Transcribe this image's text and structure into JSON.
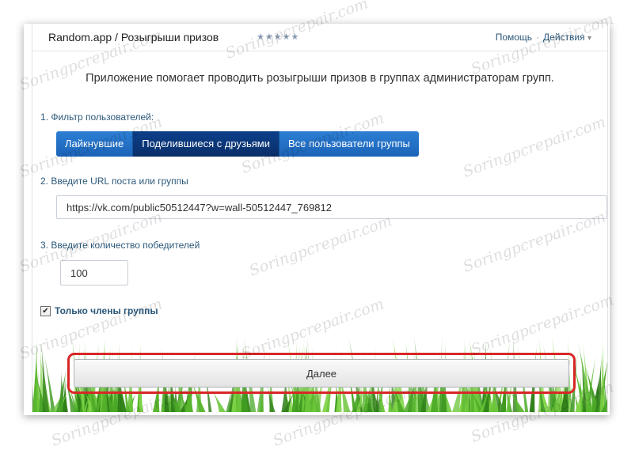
{
  "header": {
    "title": "Random.app / Розыгрыши призов",
    "stars": "★★★★★",
    "help_link": "Помощь",
    "separator": "·",
    "actions_link": "Действия",
    "actions_chevron": "▾"
  },
  "description": "Приложение помогает проводить розыгрыши призов в группах администраторам групп.",
  "filter": {
    "label": "1. Фильтр пользователей:",
    "options": [
      "Лайкнувшие",
      "Поделившиеся с друзьями",
      "Все пользователи группы"
    ],
    "active_index": 1
  },
  "url_section": {
    "label": "2. Введите URL поста или группы",
    "value": "https://vk.com/public50512447?w=wall-50512447_769812"
  },
  "winners_section": {
    "label": "3. Введите количество победителей",
    "value": "100"
  },
  "members_only": {
    "label": "Только члены группы",
    "checked": true,
    "check_glyph": "✔"
  },
  "next_button": {
    "label": "Далее"
  },
  "watermark_text": "Soringpcrepair.com",
  "colors": {
    "link_blue": "#2b587a",
    "button_blue": "#1a63b8",
    "button_active": "#0a2f68",
    "highlight_red": "#d82727",
    "grass_green": "#4caf2a"
  }
}
